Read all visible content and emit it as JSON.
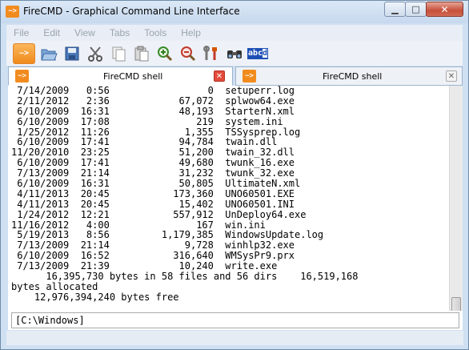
{
  "window": {
    "title": "FireCMD - Graphical Command Line Interface",
    "app_icon_text": "~>",
    "minimize_symbol": "▁",
    "maximize_symbol": "□",
    "close_symbol": "✕"
  },
  "menu": {
    "items": [
      "File",
      "Edit",
      "View",
      "Tabs",
      "Tools",
      "Help"
    ]
  },
  "toolbar": {
    "first_icon_text": "~>",
    "icons": [
      "new-shell-icon",
      "open-folder-icon",
      "save-icon",
      "cut-icon",
      "copy-icon",
      "paste-icon",
      "zoom-in-icon",
      "zoom-out-icon",
      "settings-icon",
      "find-icon",
      "text-style-icon"
    ],
    "abcd_text": "abc",
    "abcd_highlight": "d"
  },
  "tabs": [
    {
      "icon_text": "~>",
      "label": "FireCMD shell",
      "close_symbol": "✕"
    },
    {
      "icon_text": "~>",
      "label": "FireCMD shell",
      "close_symbol": "✕"
    }
  ],
  "console": {
    "lines": [
      " 7/14/2009   0:56                 0  setuperr.log",
      " 2/11/2012   2:36            67,072  splwow64.exe",
      " 6/10/2009  16:31            48,193  StarterN.xml",
      " 6/10/2009  17:08               219  system.ini",
      " 1/25/2012  11:26             1,355  TSSysprep.log",
      " 6/10/2009  17:41            94,784  twain.dll",
      "11/20/2010  23:25            51,200  twain_32.dll",
      " 6/10/2009  17:41            49,680  twunk_16.exe",
      " 7/13/2009  21:14            31,232  twunk_32.exe",
      " 6/10/2009  16:31            50,805  UltimateN.xml",
      " 4/11/2013  20:45           173,360  UNO60501.EXE",
      " 4/11/2013  20:45            15,402  UNO60501.INI",
      " 1/24/2012  12:21           557,912  UnDeploy64.exe",
      "11/16/2012   4:00               167  win.ini",
      " 5/19/2013   8:56         1,179,385  WindowsUpdate.log",
      " 7/13/2009  21:14             9,728  winhlp32.exe",
      " 6/10/2009  16:52           316,640  WMSysPr9.prx",
      " 7/13/2009  21:39            10,240  write.exe",
      "      16,395,730 bytes in 58 files and 56 dirs    16,519,168",
      "bytes allocated",
      "    12,976,394,240 bytes free",
      "",
      ""
    ],
    "prompt": "[C:\\Windows]"
  },
  "colors": {
    "accent": "#f28b1e",
    "frame": "#cfe0f2",
    "close_button": "#c7503a"
  }
}
